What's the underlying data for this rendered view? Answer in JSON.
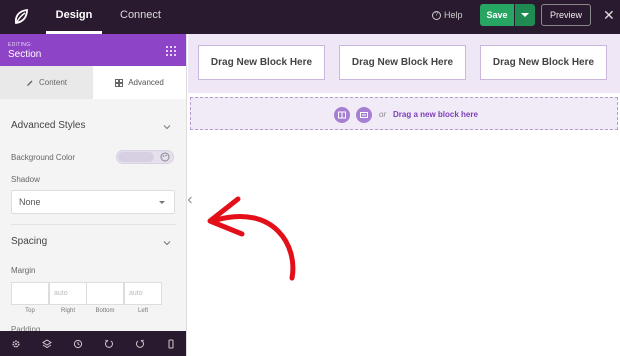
{
  "topbar": {
    "tabs": [
      "Design",
      "Connect"
    ],
    "help_label": "Help",
    "save_label": "Save",
    "preview_label": "Preview",
    "close_glyph": "✕"
  },
  "sidebar": {
    "editing_label": "EDITING:",
    "section_label": "Section",
    "tabs": {
      "content": "Content",
      "advanced": "Advanced"
    },
    "advanced_styles_title": "Advanced Styles",
    "background_color_label": "Background Color",
    "shadow_label": "Shadow",
    "shadow_value": "None",
    "spacing_title": "Spacing",
    "margin_label": "Margin",
    "margin_fields": [
      {
        "placeholder": "",
        "label": "Top"
      },
      {
        "placeholder": "auto",
        "label": "Right"
      },
      {
        "placeholder": "",
        "label": "Bottom"
      },
      {
        "placeholder": "auto",
        "label": "Left"
      }
    ],
    "padding_label": "Padding",
    "bottom_icons": [
      "settings-icon",
      "layers-icon",
      "history-icon",
      "undo-icon",
      "redo-icon",
      "mobile-preview-icon"
    ]
  },
  "canvas": {
    "drag_blocks": [
      "Drag New Block Here",
      "Drag New Block Here",
      "Drag New Block Here"
    ],
    "drop_zone": {
      "or_text": "or",
      "link_text": "Drag a new block here"
    }
  },
  "colors": {
    "topbar_bg": "#2a1a2f",
    "sidebar_header": "#8e44c7",
    "save_green": "#27a562",
    "annotation_arrow": "#e3101a"
  }
}
